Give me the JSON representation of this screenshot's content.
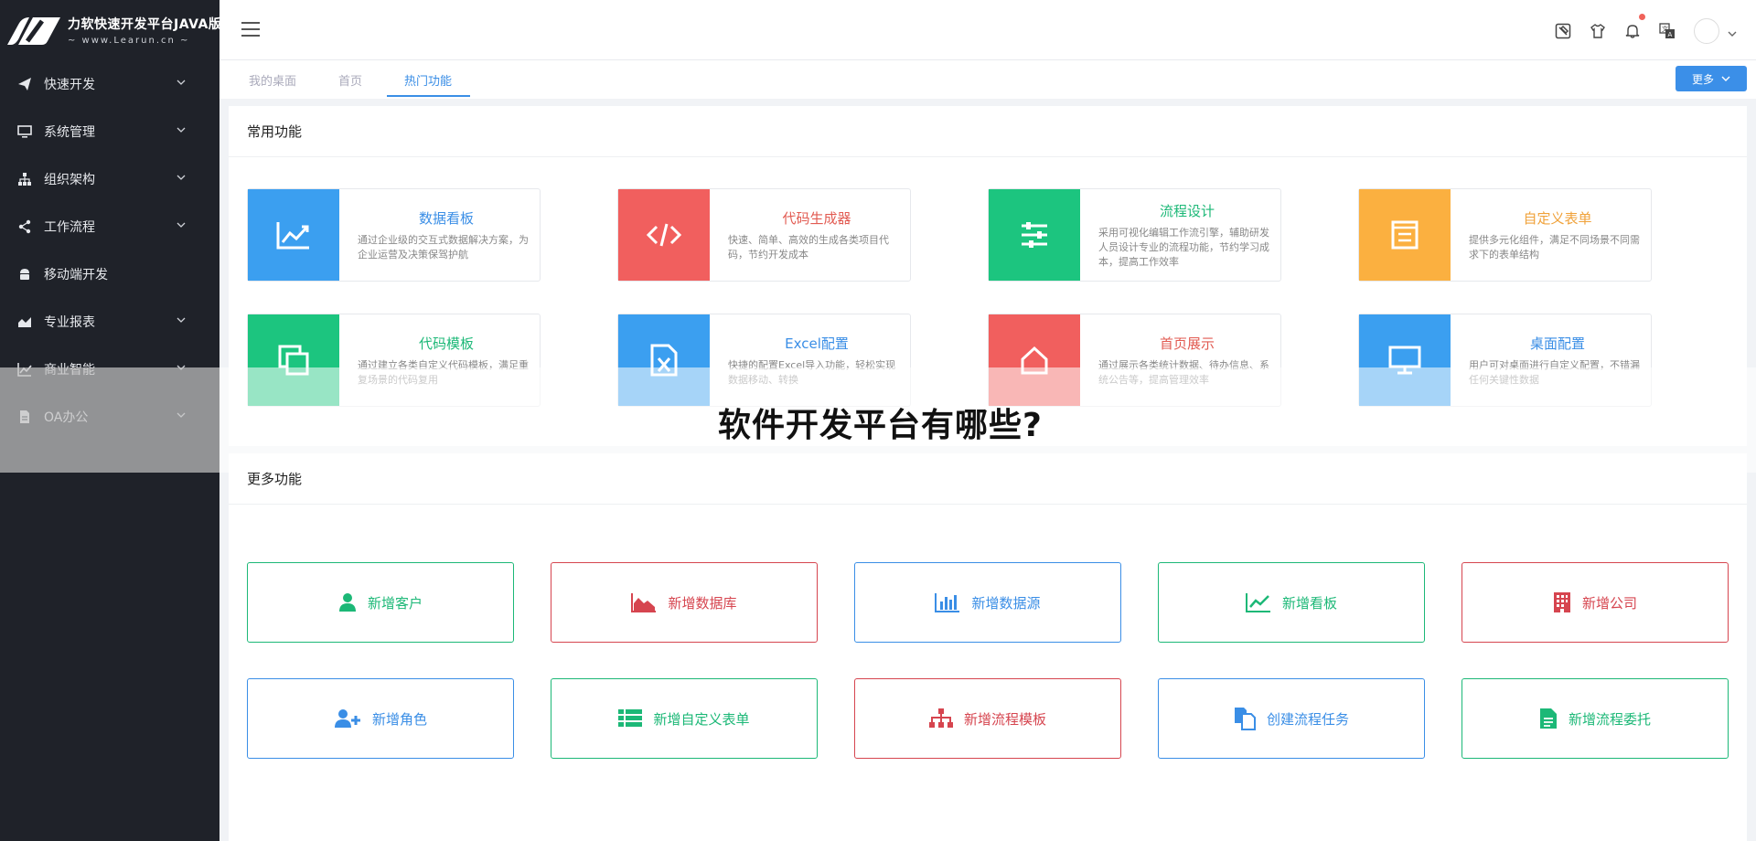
{
  "brand": {
    "title": "力软快速开发平台JAVA版",
    "subtitle": "~ www.Learun.cn ~"
  },
  "sidebar": {
    "items": [
      {
        "label": "快速开发",
        "icon": "paper-plane-icon",
        "has_children": true
      },
      {
        "label": "系统管理",
        "icon": "monitor-icon",
        "has_children": true
      },
      {
        "label": "组织架构",
        "icon": "org-chart-icon",
        "has_children": true
      },
      {
        "label": "工作流程",
        "icon": "share-icon",
        "has_children": true
      },
      {
        "label": "移动端开发",
        "icon": "android-icon",
        "has_children": false
      },
      {
        "label": "专业报表",
        "icon": "area-chart-icon",
        "has_children": true
      },
      {
        "label": "商业智能",
        "icon": "line-chart-icon",
        "has_children": true
      },
      {
        "label": "OA办公",
        "icon": "document-icon",
        "has_children": true
      }
    ]
  },
  "tabs": [
    {
      "label": "我的桌面",
      "active": false
    },
    {
      "label": "首页",
      "active": false
    },
    {
      "label": "热门功能",
      "active": true
    }
  ],
  "more_button": "更多",
  "common": {
    "title": "常用功能",
    "cards": [
      {
        "title": "数据看板",
        "desc": "通过企业级的交互式数据解决方案，为企业运营及决策保驾护航",
        "color": "#3b9ff0",
        "title_color": "#3a8ee6",
        "icon": "trend-chart-icon"
      },
      {
        "title": "代码生成器",
        "desc": "快速、简单、高效的生成各类项目代码，节约开发成本",
        "color": "#f15f5e",
        "title_color": "#e25b52",
        "icon": "code-icon"
      },
      {
        "title": "流程设计",
        "desc": "采用可视化编辑工作流引擎，辅助研发人员设计专业的流程功能，节约学习成本，提高工作效率",
        "color": "#1cc57f",
        "title_color": "#1cb877",
        "icon": "sliders-icon"
      },
      {
        "title": "自定义表单",
        "desc": "提供多元化组件，满足不同场景不同需求下的表单结构",
        "color": "#fbb040",
        "title_color": "#f0a23a",
        "icon": "form-icon"
      },
      {
        "title": "代码模板",
        "desc": "通过建立各类自定义代码模板，满足重复场景的代码复用",
        "color": "#1cc57f",
        "title_color": "#1cb877",
        "icon": "copy-icon"
      },
      {
        "title": "Excel配置",
        "desc": "快捷的配置Excel导入功能，轻松实现数据移动、转换",
        "color": "#3b9ff0",
        "title_color": "#3a8ee6",
        "icon": "excel-icon"
      },
      {
        "title": "首页展示",
        "desc": "通过展示各类统计数据、待办信息、系统公告等，提高管理效率",
        "color": "#f15f5e",
        "title_color": "#e25b52",
        "icon": "home-icon"
      },
      {
        "title": "桌面配置",
        "desc": "用户可对桌面进行自定义配置，不错漏任何关键性数据",
        "color": "#3b9ff0",
        "title_color": "#3a8ee6",
        "icon": "desktop-icon"
      }
    ]
  },
  "more_functions": {
    "title": "更多功能",
    "buttons": [
      {
        "label": "新增客户",
        "color": "#1cb877",
        "icon": "user-icon"
      },
      {
        "label": "新增数据库",
        "color": "#d6454f",
        "icon": "area-chart-icon"
      },
      {
        "label": "新增数据源",
        "color": "#3a8ee6",
        "icon": "bar-chart-icon"
      },
      {
        "label": "新增看板",
        "color": "#1cb877",
        "icon": "trend-chart-icon"
      },
      {
        "label": "新增公司",
        "color": "#d6454f",
        "icon": "building-icon"
      },
      {
        "label": "新增角色",
        "color": "#3a8ee6",
        "icon": "user-plus-icon"
      },
      {
        "label": "新增自定义表单",
        "color": "#1cb877",
        "icon": "list-icon"
      },
      {
        "label": "新增流程模板",
        "color": "#d6454f",
        "icon": "sitemap-icon"
      },
      {
        "label": "创建流程任务",
        "color": "#3a8ee6",
        "icon": "files-icon"
      },
      {
        "label": "新增流程委托",
        "color": "#1cb877",
        "icon": "file-text-icon"
      }
    ]
  },
  "overlay_text": "软件开发平台有哪些?"
}
